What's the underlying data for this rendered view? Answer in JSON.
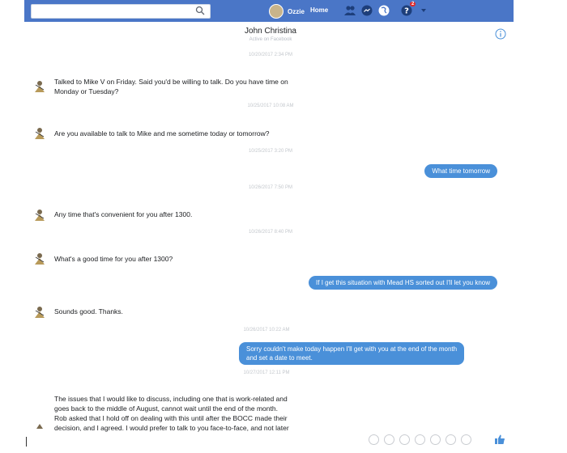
{
  "topbar": {
    "profile_name": "Ozzie",
    "home_label": "Home",
    "notification_count": "2"
  },
  "conversation": {
    "title": "John Christina",
    "subtitle": "Active on Facebook"
  },
  "timestamps": [
    "10/20/2017 2:34 PM",
    "10/25/2017 10:08 AM",
    "10/25/2017 3:20 PM",
    "10/26/2017 7:50 PM",
    "10/26/2017 8:40 PM",
    "10/26/2017 10:22 AM",
    "10/27/2017 12:11 PM"
  ],
  "messages": [
    {
      "side": "in",
      "lines": [
        "Talked to Mike V on Friday. Said you'd be willing to talk. Do you have time on",
        "Monday or Tuesday?"
      ]
    },
    {
      "side": "in",
      "lines": [
        "Are you available to talk to Mike and me sometime today or tomorrow?"
      ]
    },
    {
      "side": "out",
      "lines": [
        "What time tomorrow"
      ]
    },
    {
      "side": "in",
      "lines": [
        "Any time that's convenient for you after 1300."
      ]
    },
    {
      "side": "in",
      "lines": [
        "What's a good time for you after 1300?"
      ]
    },
    {
      "side": "out",
      "lines": [
        "If I get this situation with Mead HS sorted out I'll let you know"
      ]
    },
    {
      "side": "in",
      "lines": [
        "Sounds good. Thanks."
      ]
    },
    {
      "side": "out",
      "lines": [
        "Sorry couldn't make today happen I'll get with you at the end of the month",
        "and set a date to meet."
      ]
    },
    {
      "side": "in",
      "lines": [
        "The issues that I would like to discuss, including one that is work-related and",
        "goes back to the middle of August, cannot wait until the end of the month.",
        "Rob asked that I hold off on dealing with this until after the BOCC made their",
        "decision, and I agreed. I would prefer to talk to you face-to-face, and not later"
      ]
    }
  ],
  "icons": {
    "search": "search-icon",
    "friends": "friends-icon",
    "messenger": "messenger-icon",
    "globe": "notifications-icon",
    "help": "help-icon",
    "dropdown": "chevron-down-icon",
    "info": "info-icon",
    "like": "thumbs-up-icon"
  },
  "colors": {
    "topbar": "#4a76c7",
    "bubble_out": "#4a90d9"
  }
}
